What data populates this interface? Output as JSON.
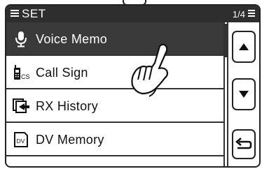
{
  "header": {
    "title": "SET",
    "page_indicator": "1/4"
  },
  "menu": {
    "items": [
      {
        "label": "Voice Memo",
        "icon": "microphone-icon",
        "selected": true
      },
      {
        "label": "Call Sign",
        "icon": "call-sign-icon",
        "selected": false
      },
      {
        "label": "RX History",
        "icon": "rx-history-icon",
        "selected": false
      },
      {
        "label": "DV Memory",
        "icon": "dv-memory-icon",
        "selected": false
      }
    ]
  },
  "icons": {
    "call_sign_small": "CS",
    "dv_memory_small": "DV"
  },
  "buttons": {
    "scroll_up": "up-arrow-icon",
    "scroll_down": "down-arrow-icon",
    "back": "return-icon"
  },
  "colors": {
    "title_bar": "#2e2e2e",
    "selected_row": "#3a3a3a"
  }
}
